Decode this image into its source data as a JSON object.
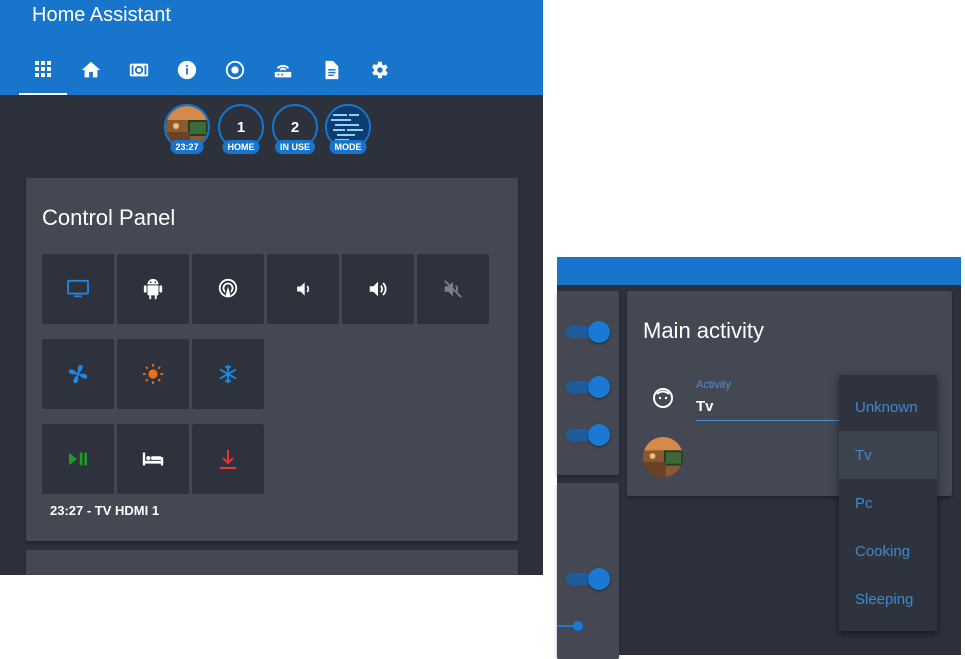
{
  "app": {
    "title": "Home Assistant"
  },
  "tabs": [
    {
      "name": "grid-icon",
      "active": true
    },
    {
      "name": "home-icon"
    },
    {
      "name": "camera-icon"
    },
    {
      "name": "info-icon"
    },
    {
      "name": "target-icon"
    },
    {
      "name": "router-icon"
    },
    {
      "name": "document-icon"
    },
    {
      "name": "gear-icon"
    }
  ],
  "badges": [
    {
      "value": "",
      "label": "23:27",
      "kind": "image"
    },
    {
      "value": "1",
      "label": "HOME"
    },
    {
      "value": "2",
      "label": "IN USE"
    },
    {
      "value": "",
      "label": "MODE",
      "kind": "code-image"
    }
  ],
  "control_panel": {
    "title": "Control Panel",
    "status": "23:27 - TV HDMI 1",
    "buttons": [
      {
        "icon": "monitor-icon",
        "color": "#1e88e5"
      },
      {
        "icon": "android-icon",
        "color": "#ffffff"
      },
      {
        "icon": "airplay-icon",
        "color": "#ffffff"
      },
      {
        "icon": "volume-down-icon",
        "color": "#ffffff"
      },
      {
        "icon": "volume-up-icon",
        "color": "#ffffff"
      },
      {
        "icon": "volume-mute-icon",
        "color": "#7a7f88"
      },
      {
        "icon": "fan-icon",
        "color": "#1e88e5"
      },
      {
        "icon": "sun-icon",
        "color": "#e8711a"
      },
      {
        "icon": "snowflake-icon",
        "color": "#1e88e5"
      },
      {
        "icon": "play-pause-icon",
        "color": "#1e9a2a"
      },
      {
        "icon": "bed-icon",
        "color": "#ffffff"
      },
      {
        "icon": "download-icon",
        "color": "#e53935"
      }
    ]
  },
  "main_activity": {
    "title": "Main activity",
    "field_label": "Activity",
    "field_value": "Tv",
    "options": [
      {
        "label": "Unknown",
        "selected": false
      },
      {
        "label": "Tv",
        "selected": true
      },
      {
        "label": "Pc",
        "selected": false
      },
      {
        "label": "Cooking",
        "selected": false
      },
      {
        "label": "Sleeping",
        "selected": false
      }
    ]
  },
  "colors": {
    "accent": "#1776cc",
    "background": "#2c313c",
    "card": "#434853"
  }
}
